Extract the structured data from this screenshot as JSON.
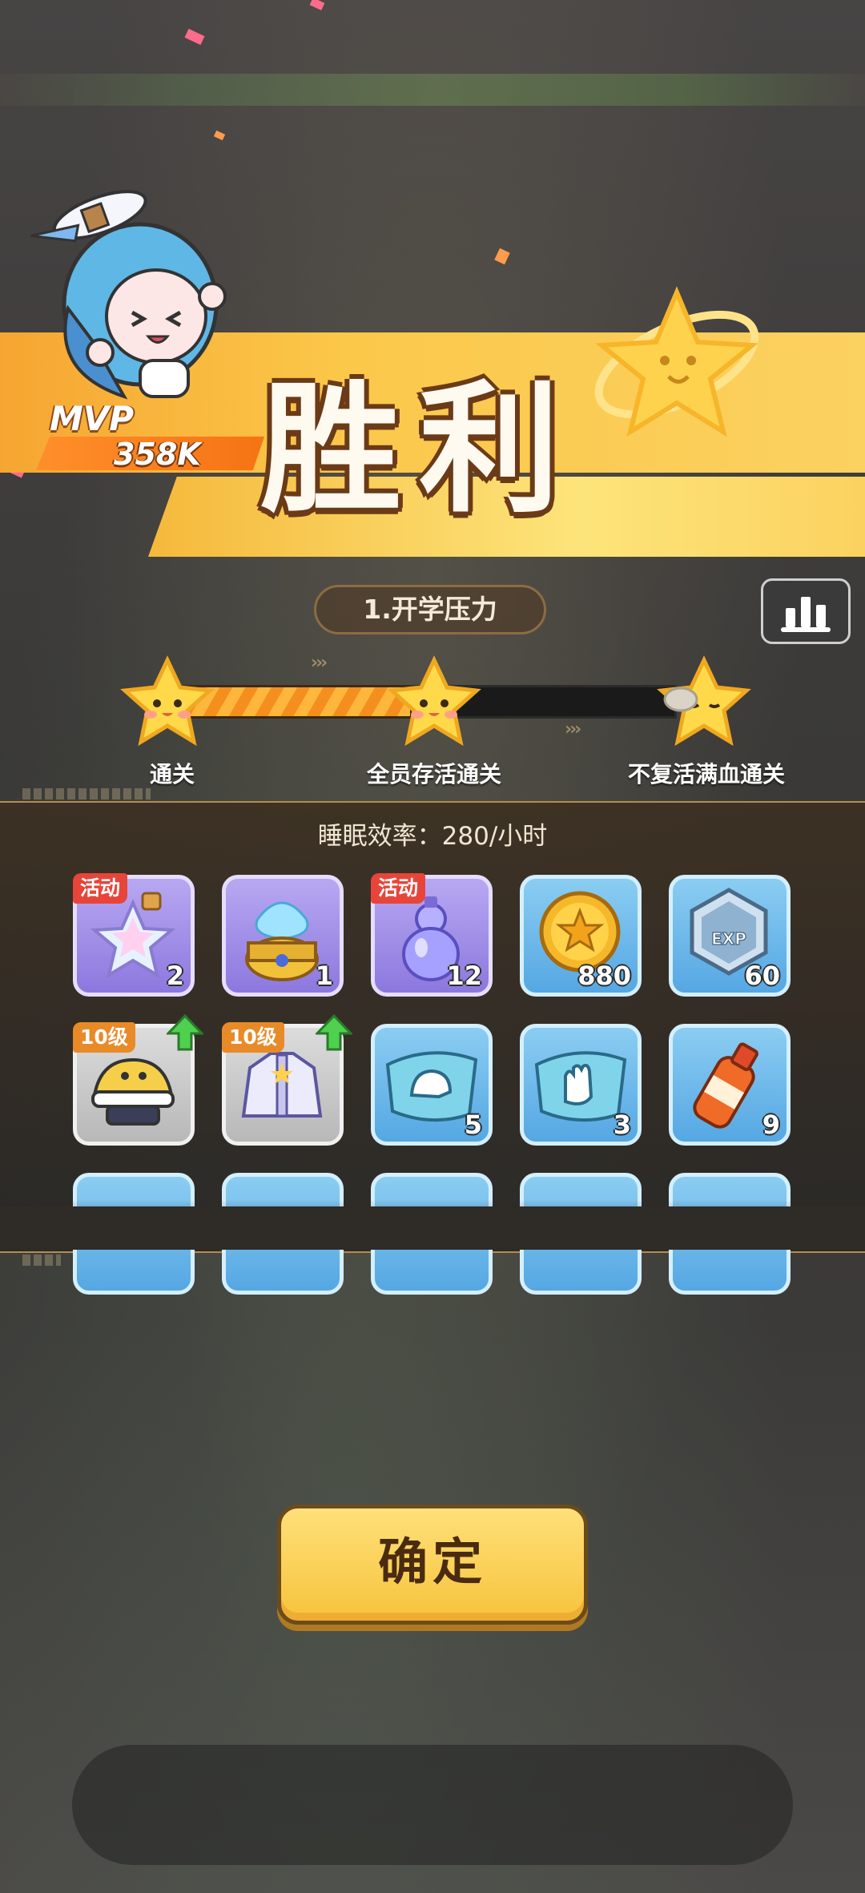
{
  "screen": {
    "title": "胜利"
  },
  "mvp": {
    "label": "MVP",
    "score": "358K"
  },
  "level": {
    "name": "1.开学压力"
  },
  "objectives": [
    {
      "label": "通关",
      "achieved": true
    },
    {
      "label": "全员存活通关",
      "achieved": true
    },
    {
      "label": "不复活满血通关",
      "achieved": false
    }
  ],
  "rewards": {
    "sleep_efficiency": "睡眠效率：280/小时",
    "items": [
      {
        "icon": "rainbow-star-bottle-icon",
        "quantity": "2",
        "tag": "活动",
        "rarity": "purple"
      },
      {
        "icon": "spirit-jar-icon",
        "quantity": "1",
        "tag": "",
        "rarity": "purple"
      },
      {
        "icon": "gourd-bottle-icon",
        "quantity": "12",
        "tag": "活动",
        "rarity": "purple"
      },
      {
        "icon": "gold-coin-icon",
        "quantity": "880",
        "tag": "",
        "rarity": "blue"
      },
      {
        "icon": "exp-badge-icon",
        "quantity": "60",
        "tag": "",
        "rarity": "blue"
      },
      {
        "icon": "helmet-hat-icon",
        "quantity": "",
        "tag": "10级",
        "rarity": "gray",
        "upgrade": true
      },
      {
        "icon": "jacket-icon",
        "quantity": "",
        "tag": "10级",
        "rarity": "gray",
        "upgrade": true
      },
      {
        "icon": "helmet-blueprint-icon",
        "quantity": "5",
        "tag": "",
        "rarity": "blue"
      },
      {
        "icon": "glove-blueprint-icon",
        "quantity": "3",
        "tag": "",
        "rarity": "blue"
      },
      {
        "icon": "energy-drink-icon",
        "quantity": "9",
        "tag": "",
        "rarity": "blue"
      }
    ]
  },
  "buttons": {
    "confirm": "确定"
  },
  "colors": {
    "banner": "#fbc84a",
    "panel_border": "#b58d4c",
    "confirm": "#f6c33b"
  }
}
